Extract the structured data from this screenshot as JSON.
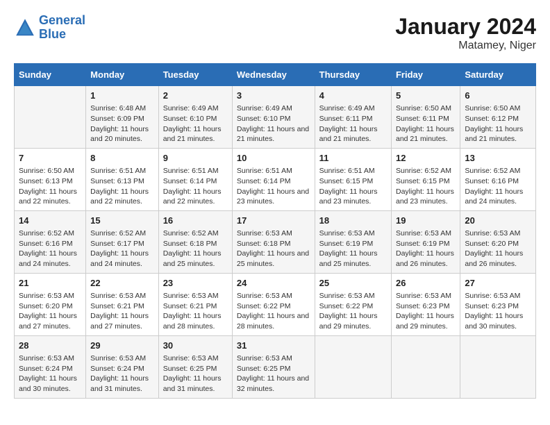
{
  "header": {
    "logo_line1": "General",
    "logo_line2": "Blue",
    "main_title": "January 2024",
    "subtitle": "Matamey, Niger"
  },
  "columns": [
    "Sunday",
    "Monday",
    "Tuesday",
    "Wednesday",
    "Thursday",
    "Friday",
    "Saturday"
  ],
  "rows": [
    [
      {
        "day": "",
        "sunrise": "",
        "sunset": "",
        "daylight": ""
      },
      {
        "day": "1",
        "sunrise": "Sunrise: 6:48 AM",
        "sunset": "Sunset: 6:09 PM",
        "daylight": "Daylight: 11 hours and 20 minutes."
      },
      {
        "day": "2",
        "sunrise": "Sunrise: 6:49 AM",
        "sunset": "Sunset: 6:10 PM",
        "daylight": "Daylight: 11 hours and 21 minutes."
      },
      {
        "day": "3",
        "sunrise": "Sunrise: 6:49 AM",
        "sunset": "Sunset: 6:10 PM",
        "daylight": "Daylight: 11 hours and 21 minutes."
      },
      {
        "day": "4",
        "sunrise": "Sunrise: 6:49 AM",
        "sunset": "Sunset: 6:11 PM",
        "daylight": "Daylight: 11 hours and 21 minutes."
      },
      {
        "day": "5",
        "sunrise": "Sunrise: 6:50 AM",
        "sunset": "Sunset: 6:11 PM",
        "daylight": "Daylight: 11 hours and 21 minutes."
      },
      {
        "day": "6",
        "sunrise": "Sunrise: 6:50 AM",
        "sunset": "Sunset: 6:12 PM",
        "daylight": "Daylight: 11 hours and 21 minutes."
      }
    ],
    [
      {
        "day": "7",
        "sunrise": "Sunrise: 6:50 AM",
        "sunset": "Sunset: 6:13 PM",
        "daylight": "Daylight: 11 hours and 22 minutes."
      },
      {
        "day": "8",
        "sunrise": "Sunrise: 6:51 AM",
        "sunset": "Sunset: 6:13 PM",
        "daylight": "Daylight: 11 hours and 22 minutes."
      },
      {
        "day": "9",
        "sunrise": "Sunrise: 6:51 AM",
        "sunset": "Sunset: 6:14 PM",
        "daylight": "Daylight: 11 hours and 22 minutes."
      },
      {
        "day": "10",
        "sunrise": "Sunrise: 6:51 AM",
        "sunset": "Sunset: 6:14 PM",
        "daylight": "Daylight: 11 hours and 23 minutes."
      },
      {
        "day": "11",
        "sunrise": "Sunrise: 6:51 AM",
        "sunset": "Sunset: 6:15 PM",
        "daylight": "Daylight: 11 hours and 23 minutes."
      },
      {
        "day": "12",
        "sunrise": "Sunrise: 6:52 AM",
        "sunset": "Sunset: 6:15 PM",
        "daylight": "Daylight: 11 hours and 23 minutes."
      },
      {
        "day": "13",
        "sunrise": "Sunrise: 6:52 AM",
        "sunset": "Sunset: 6:16 PM",
        "daylight": "Daylight: 11 hours and 24 minutes."
      }
    ],
    [
      {
        "day": "14",
        "sunrise": "Sunrise: 6:52 AM",
        "sunset": "Sunset: 6:16 PM",
        "daylight": "Daylight: 11 hours and 24 minutes."
      },
      {
        "day": "15",
        "sunrise": "Sunrise: 6:52 AM",
        "sunset": "Sunset: 6:17 PM",
        "daylight": "Daylight: 11 hours and 24 minutes."
      },
      {
        "day": "16",
        "sunrise": "Sunrise: 6:52 AM",
        "sunset": "Sunset: 6:18 PM",
        "daylight": "Daylight: 11 hours and 25 minutes."
      },
      {
        "day": "17",
        "sunrise": "Sunrise: 6:53 AM",
        "sunset": "Sunset: 6:18 PM",
        "daylight": "Daylight: 11 hours and 25 minutes."
      },
      {
        "day": "18",
        "sunrise": "Sunrise: 6:53 AM",
        "sunset": "Sunset: 6:19 PM",
        "daylight": "Daylight: 11 hours and 25 minutes."
      },
      {
        "day": "19",
        "sunrise": "Sunrise: 6:53 AM",
        "sunset": "Sunset: 6:19 PM",
        "daylight": "Daylight: 11 hours and 26 minutes."
      },
      {
        "day": "20",
        "sunrise": "Sunrise: 6:53 AM",
        "sunset": "Sunset: 6:20 PM",
        "daylight": "Daylight: 11 hours and 26 minutes."
      }
    ],
    [
      {
        "day": "21",
        "sunrise": "Sunrise: 6:53 AM",
        "sunset": "Sunset: 6:20 PM",
        "daylight": "Daylight: 11 hours and 27 minutes."
      },
      {
        "day": "22",
        "sunrise": "Sunrise: 6:53 AM",
        "sunset": "Sunset: 6:21 PM",
        "daylight": "Daylight: 11 hours and 27 minutes."
      },
      {
        "day": "23",
        "sunrise": "Sunrise: 6:53 AM",
        "sunset": "Sunset: 6:21 PM",
        "daylight": "Daylight: 11 hours and 28 minutes."
      },
      {
        "day": "24",
        "sunrise": "Sunrise: 6:53 AM",
        "sunset": "Sunset: 6:22 PM",
        "daylight": "Daylight: 11 hours and 28 minutes."
      },
      {
        "day": "25",
        "sunrise": "Sunrise: 6:53 AM",
        "sunset": "Sunset: 6:22 PM",
        "daylight": "Daylight: 11 hours and 29 minutes."
      },
      {
        "day": "26",
        "sunrise": "Sunrise: 6:53 AM",
        "sunset": "Sunset: 6:23 PM",
        "daylight": "Daylight: 11 hours and 29 minutes."
      },
      {
        "day": "27",
        "sunrise": "Sunrise: 6:53 AM",
        "sunset": "Sunset: 6:23 PM",
        "daylight": "Daylight: 11 hours and 30 minutes."
      }
    ],
    [
      {
        "day": "28",
        "sunrise": "Sunrise: 6:53 AM",
        "sunset": "Sunset: 6:24 PM",
        "daylight": "Daylight: 11 hours and 30 minutes."
      },
      {
        "day": "29",
        "sunrise": "Sunrise: 6:53 AM",
        "sunset": "Sunset: 6:24 PM",
        "daylight": "Daylight: 11 hours and 31 minutes."
      },
      {
        "day": "30",
        "sunrise": "Sunrise: 6:53 AM",
        "sunset": "Sunset: 6:25 PM",
        "daylight": "Daylight: 11 hours and 31 minutes."
      },
      {
        "day": "31",
        "sunrise": "Sunrise: 6:53 AM",
        "sunset": "Sunset: 6:25 PM",
        "daylight": "Daylight: 11 hours and 32 minutes."
      },
      {
        "day": "",
        "sunrise": "",
        "sunset": "",
        "daylight": ""
      },
      {
        "day": "",
        "sunrise": "",
        "sunset": "",
        "daylight": ""
      },
      {
        "day": "",
        "sunrise": "",
        "sunset": "",
        "daylight": ""
      }
    ]
  ]
}
